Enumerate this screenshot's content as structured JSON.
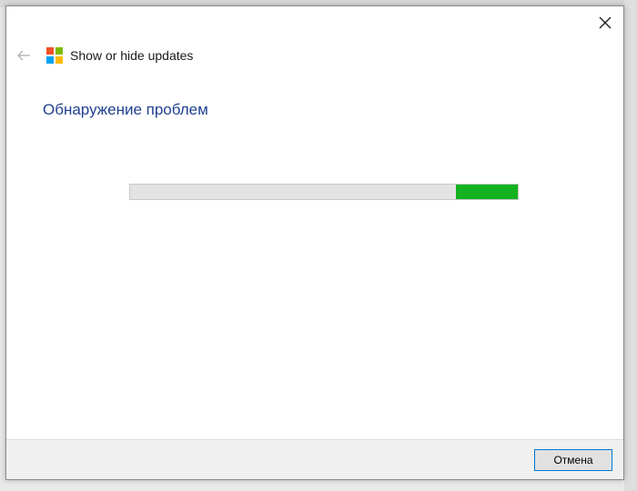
{
  "window": {
    "title": "Show or hide updates",
    "close_icon": "close-icon",
    "back_icon": "arrow-left-icon",
    "app_icon": "windows-logo-icon"
  },
  "page": {
    "heading": "Обнаружение проблем"
  },
  "progress": {
    "mode": "indeterminate",
    "segment_start": 0.84,
    "segment_fraction": 0.16,
    "fill_color": "#13b21f",
    "track_color": "#e3e3e3"
  },
  "footer": {
    "cancel_label": "Отмена"
  },
  "colors": {
    "heading": "#1f3f8f",
    "accent_border": "#0078d7",
    "logo_red": "#f25022",
    "logo_green": "#7fba00",
    "logo_blue": "#00a4ef",
    "logo_yellow": "#ffb900"
  }
}
